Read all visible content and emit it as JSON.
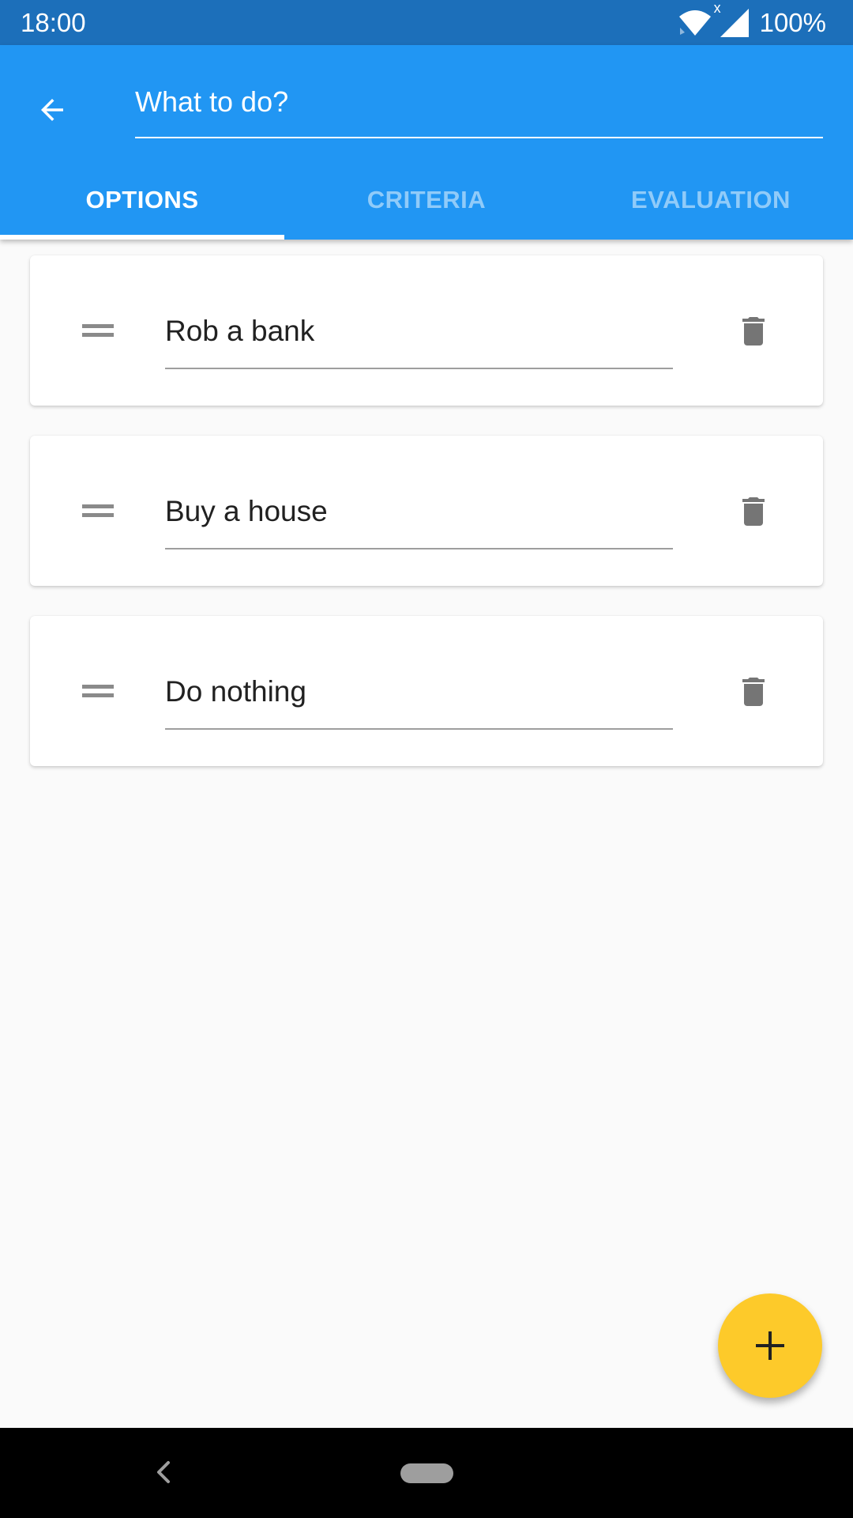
{
  "status_bar": {
    "time": "18:00",
    "battery": "100%",
    "signal_mark": "x"
  },
  "app_bar": {
    "title": "What to do?",
    "back_icon": "arrow-back-icon"
  },
  "tabs": [
    {
      "label": "OPTIONS",
      "active": true
    },
    {
      "label": "CRITERIA",
      "active": false
    },
    {
      "label": "EVALUATION",
      "active": false
    }
  ],
  "options": [
    {
      "label": "Rob a bank"
    },
    {
      "label": "Buy a house"
    },
    {
      "label": "Do nothing"
    }
  ],
  "icons": {
    "drag": "drag-handle-icon",
    "delete": "trash-icon",
    "add": "plus-icon"
  },
  "colors": {
    "primary": "#2196f3",
    "status_bar": "#1c6fba",
    "fab": "#fdca2a",
    "background": "#fafafa"
  }
}
